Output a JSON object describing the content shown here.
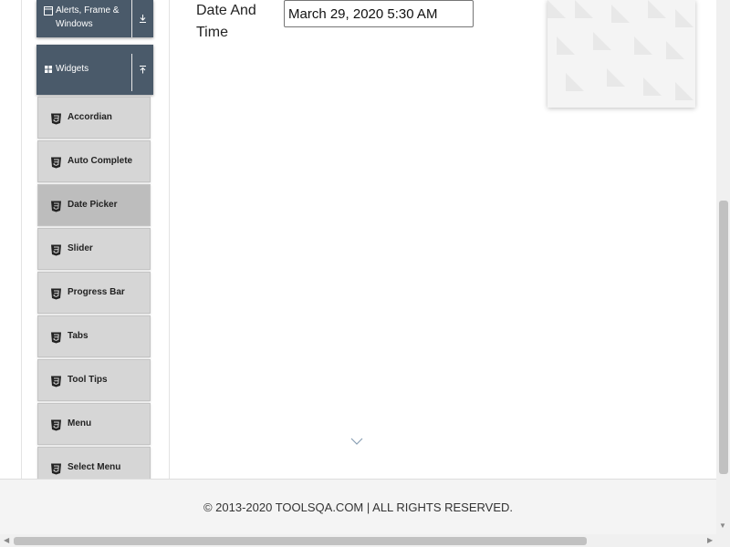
{
  "sidebar": {
    "groups": [
      {
        "label_line1": "Alerts, Frame &",
        "label_line2": "Windows",
        "icon": "window-icon",
        "toggle_icon": "download-arrow-icon"
      },
      {
        "label": "Widgets",
        "icon": "grid-icon",
        "toggle_icon": "upload-arrow-icon",
        "expanded": true
      }
    ],
    "items": [
      {
        "label": "Accordian",
        "icon": "html5-icon"
      },
      {
        "label": "Auto Complete",
        "icon": "html5-icon"
      },
      {
        "label": "Date Picker",
        "icon": "html5-icon",
        "active": true
      },
      {
        "label": "Slider",
        "icon": "html5-icon"
      },
      {
        "label": "Progress Bar",
        "icon": "html5-icon"
      },
      {
        "label": "Tabs",
        "icon": "html5-icon"
      },
      {
        "label": "Tool Tips",
        "icon": "html5-icon"
      },
      {
        "label": "Menu",
        "icon": "html5-icon"
      },
      {
        "label": "Select Menu",
        "icon": "html5-icon"
      }
    ]
  },
  "main": {
    "date_time_label": "Date And Time",
    "date_time_value": "March 29, 2020 5:30 AM"
  },
  "footer": {
    "text": "© 2013-2020 TOOLSQA.COM | ALL RIGHTS RESERVED."
  },
  "colors": {
    "group_bg": "#4a5a6a",
    "item_bg": "#d6d6d6",
    "item_active_bg": "#bdbdbd",
    "footer_bg": "#f4f4f4"
  }
}
